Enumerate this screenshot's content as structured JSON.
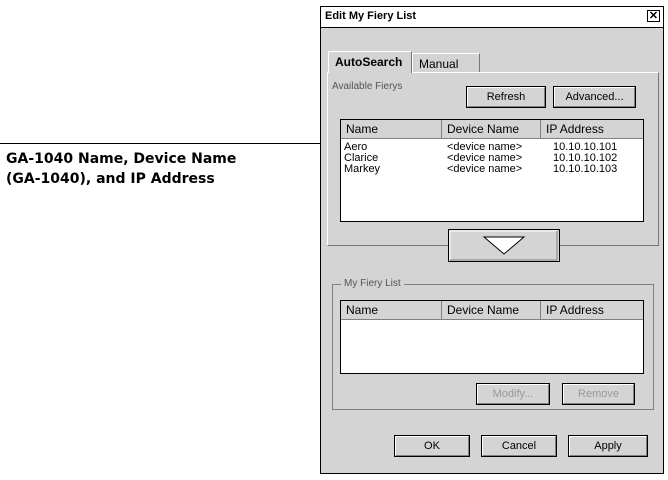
{
  "annotation": {
    "line1": "GA-1040 Name, Device Name",
    "line2": "(GA-1040), and IP Address"
  },
  "window": {
    "title": "Edit My Fiery List",
    "close_glyph": "✕"
  },
  "tabs": [
    {
      "label": "AutoSearch",
      "active": true
    },
    {
      "label": "Manual",
      "active": false
    }
  ],
  "autosearch": {
    "available_label": "Available Fierys",
    "refresh_label": "Refresh",
    "advanced_label": "Advanced...",
    "columns": [
      "Name",
      "Device Name",
      "IP Address"
    ],
    "rows": [
      {
        "name": "Aero",
        "device": "<device name>",
        "ip": "10.10.10.101"
      },
      {
        "name": "Clarice",
        "device": "<device name>",
        "ip": "10.10.10.102"
      },
      {
        "name": "Markey",
        "device": "<device name>",
        "ip": "10.10.10.103"
      }
    ],
    "add_button_icon": "down-triangle-icon"
  },
  "my_list": {
    "label": "My Fiery List",
    "columns": [
      "Name",
      "Device Name",
      "IP Address"
    ],
    "rows": [],
    "modify_label": "Modify...",
    "remove_label": "Remove"
  },
  "footer": {
    "ok_label": "OK",
    "cancel_label": "Cancel",
    "apply_label": "Apply"
  }
}
